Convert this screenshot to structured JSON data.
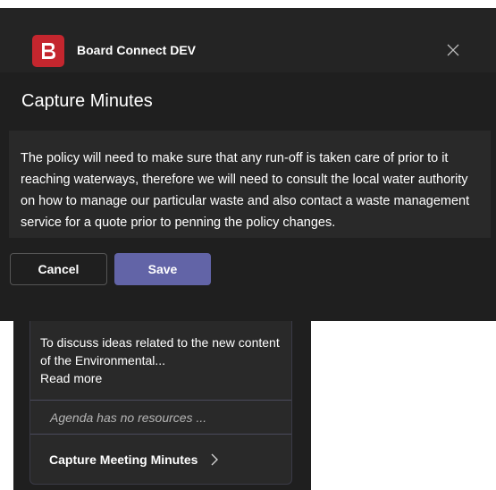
{
  "app": {
    "title": "Board Connect DEV",
    "logo_letter": "B",
    "brand_color": "#c4262e"
  },
  "dialog": {
    "title": "Capture Minutes",
    "minutes_text": "The policy will need to make sure that any run-off is taken care of prior to it reaching waterways, therefore we will need to consult the local water authority on how to manage our particular waste and also contact a waste management service for a quote prior to penning the policy changes.",
    "cancel_label": "Cancel",
    "save_label": "Save",
    "accent_color": "#6264a7"
  },
  "agenda": {
    "description": "To discuss ideas related to the new content of the Environmental...",
    "read_more": "Read more",
    "no_resources": "Agenda has no resources ...",
    "capture_link": "Capture Meeting Minutes"
  },
  "icons": {
    "close": "close-icon",
    "chevron": "chevron-right-icon"
  }
}
